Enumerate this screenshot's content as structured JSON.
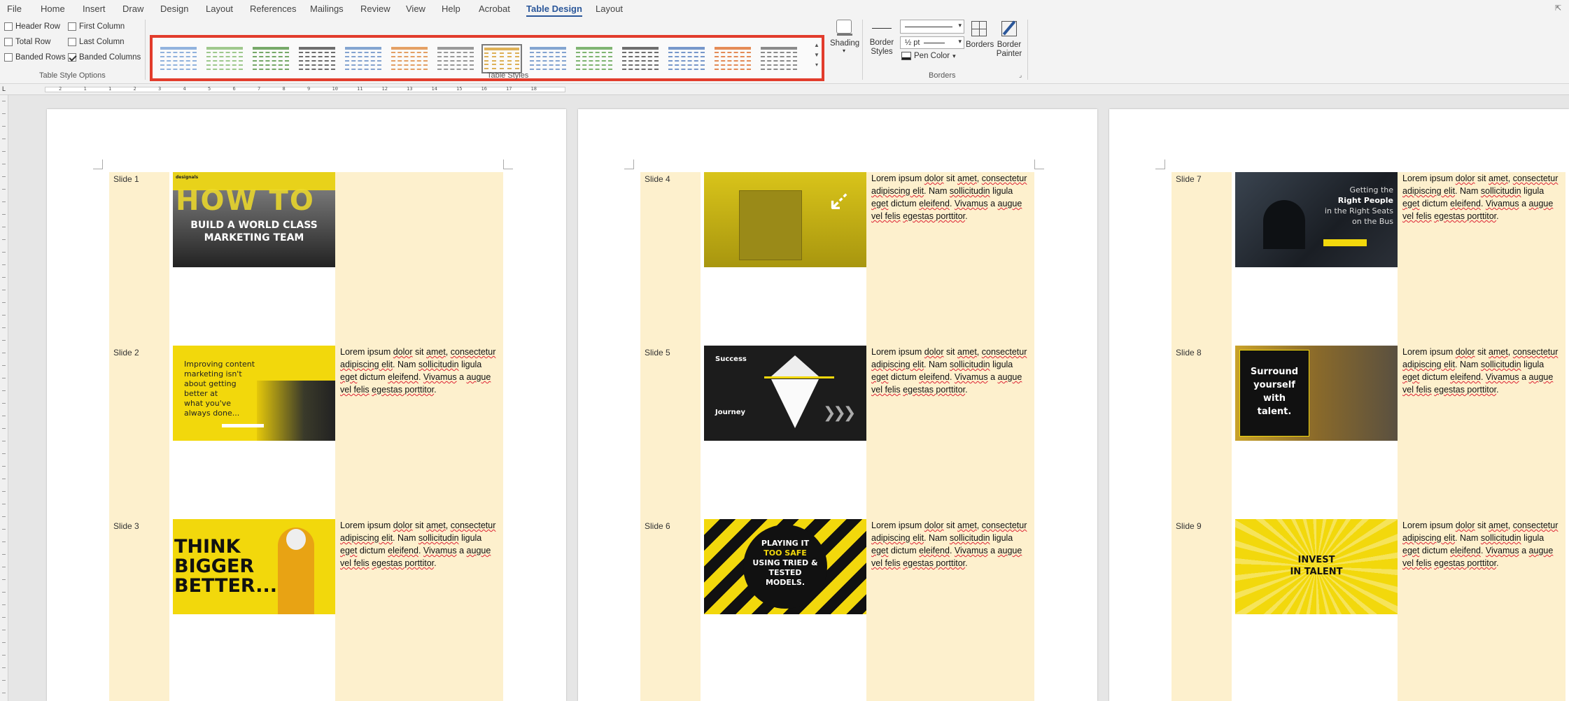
{
  "menu": [
    "File",
    "Home",
    "Insert",
    "Draw",
    "Design",
    "Layout",
    "References",
    "Mailings",
    "Review",
    "View",
    "Help",
    "Acrobat",
    "Table Design",
    "Layout"
  ],
  "active_menu": "Table Design",
  "table_style_options": {
    "header_row": {
      "label": "Header Row",
      "checked": false
    },
    "first_column": {
      "label": "First Column",
      "checked": false
    },
    "total_row": {
      "label": "Total Row",
      "checked": false
    },
    "last_column": {
      "label": "Last Column",
      "checked": false
    },
    "banded_rows": {
      "label": "Banded Rows",
      "checked": false
    },
    "banded_columns": {
      "label": "Banded Columns",
      "checked": true
    },
    "group_label": "Table Style Options"
  },
  "table_styles": {
    "group_label": "Table Styles",
    "swatch_colors": [
      "#7fa6d8",
      "#8fc07a",
      "#5f9a4f",
      "#555555",
      "#6f95c9",
      "#e0904a",
      "#888888",
      "#d9a43a",
      "#6f95c9",
      "#6aa85a",
      "#555555",
      "#5f86c2",
      "#e0783a",
      "#777777"
    ],
    "selected_index": 7
  },
  "shading": {
    "label": "Shading"
  },
  "borders": {
    "border_styles_label": "Border Styles",
    "pen_weight": "½ pt",
    "pen_color_label": "Pen Color",
    "borders_label": "Borders",
    "border_painter_label": "Border Painter",
    "group_label": "Borders"
  },
  "ruler_numbers": [
    "2",
    "1",
    "1",
    "2",
    "3",
    "4",
    "5",
    "6",
    "7",
    "8",
    "9",
    "10",
    "11",
    "12",
    "13",
    "14",
    "15",
    "16",
    "17",
    "18"
  ],
  "lorem": {
    "w1": "Lorem ipsum",
    "w2": "dolor",
    "w3": "sit",
    "w4": "amet",
    "w5": "consectetur adipiscing elit",
    "w6": "Nam",
    "w7": "sollicitudin",
    "w8": "ligula",
    "w9": "eget",
    "w10": "dictum",
    "w11": "eleifend",
    "w12": "Vivamus",
    "w13": "a",
    "w14": "augue vel felis",
    "w15": "egestas porttitor"
  },
  "slides": [
    {
      "label": "Slide 1",
      "has_text": false,
      "thumb": {
        "brand": "designals",
        "title": "HOW TO",
        "sub1": "BUILD A WORLD CLASS",
        "sub2": "MARKETING TEAM"
      }
    },
    {
      "label": "Slide 2",
      "has_text": true,
      "thumb": {
        "line1": "Improving content",
        "line2": "marketing isn't",
        "line3": "about getting",
        "line4": "better at",
        "line5": "what you've",
        "line6": "always done..."
      }
    },
    {
      "label": "Slide 3",
      "has_text": true,
      "thumb": {
        "line1": "THINK",
        "line2": "BIGGER",
        "line3": "BETTER..."
      }
    },
    {
      "label": "Slide 4",
      "has_text": true,
      "thumb": {}
    },
    {
      "label": "Slide 5",
      "has_text": true,
      "thumb": {
        "top": "Success",
        "bottom": "Journey"
      }
    },
    {
      "label": "Slide 6",
      "has_text": true,
      "thumb": {
        "line1": "PLAYING IT",
        "line2": "TOO SAFE",
        "line3": "USING TRIED &",
        "line4": "TESTED",
        "line5": "MODELS."
      }
    },
    {
      "label": "Slide 7",
      "has_text": true,
      "thumb": {
        "line1": "Getting the",
        "line2": "Right People",
        "line3": "in the Right Seats",
        "line4": "on the Bus"
      }
    },
    {
      "label": "Slide 8",
      "has_text": true,
      "thumb": {
        "line1": "Surround",
        "line2": "yourself",
        "line3": "with",
        "line4": "talent."
      }
    },
    {
      "label": "Slide 9",
      "has_text": true,
      "thumb": {
        "line1": "INVEST",
        "line2": "IN TALENT"
      }
    }
  ]
}
